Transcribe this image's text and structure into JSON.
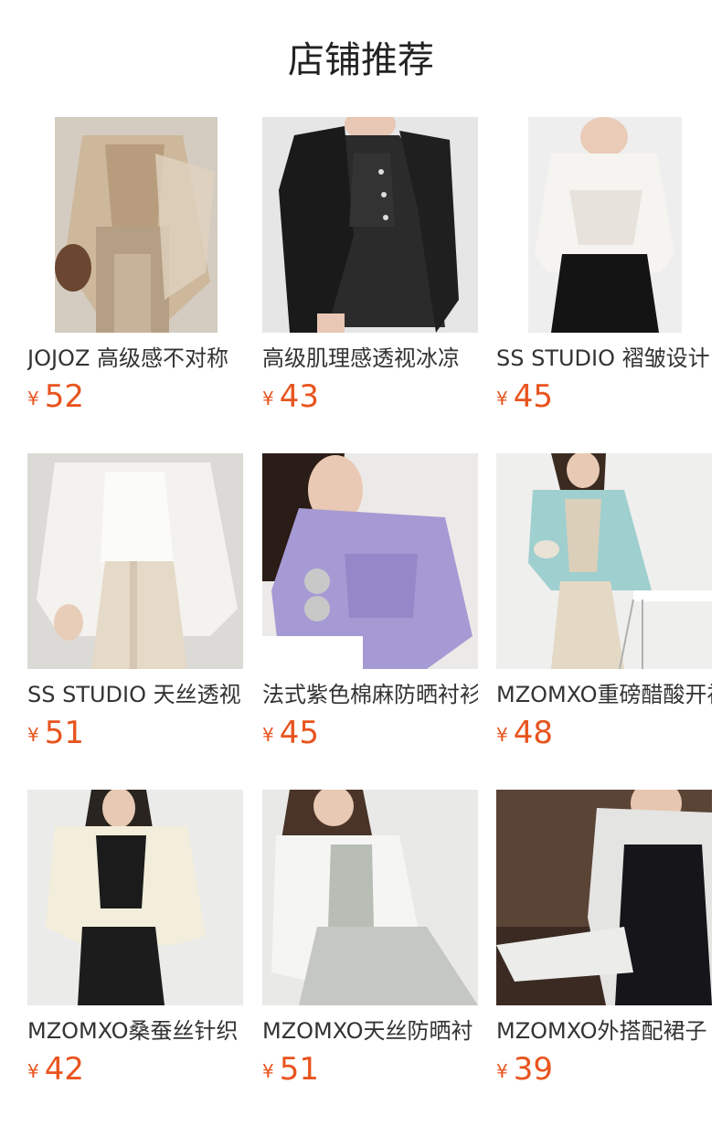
{
  "header": {
    "title": "店铺推荐"
  },
  "products": [
    {
      "name": "JOJOZ 高级感不对称",
      "currency": "¥",
      "price": "52"
    },
    {
      "name": "高级肌理感透视冰凉",
      "currency": "¥",
      "price": "43"
    },
    {
      "name": "SS STUDIO 褶皱设计",
      "currency": "¥",
      "price": "45"
    },
    {
      "name": "SS STUDIO 天丝透视",
      "currency": "¥",
      "price": "51"
    },
    {
      "name": "法式紫色棉麻防晒衬衫",
      "currency": "¥",
      "price": "45"
    },
    {
      "name": "MZOMXO重磅醋酸开衫",
      "currency": "¥",
      "price": "48"
    },
    {
      "name": "MZOMXO桑蚕丝针织",
      "currency": "¥",
      "price": "42"
    },
    {
      "name": "MZOMXO天丝防晒衬",
      "currency": "¥",
      "price": "51"
    },
    {
      "name": "MZOMXO外搭配裙子",
      "currency": "¥",
      "price": "39"
    }
  ],
  "colors": {
    "price": "#e8541e",
    "text": "#333333",
    "title": "#222222"
  }
}
